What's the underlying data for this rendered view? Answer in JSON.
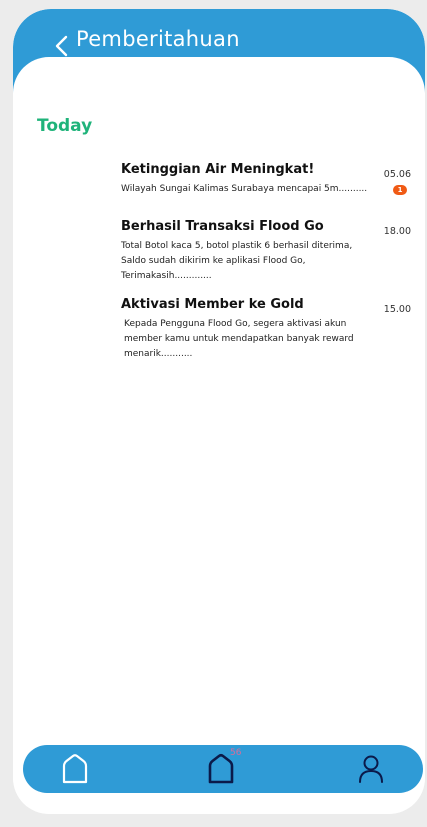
{
  "header": {
    "title": "Pemberitahuan"
  },
  "section": {
    "label": "Today"
  },
  "notifications": [
    {
      "title": "Ketinggian Air Meningkat!",
      "body": "Wilayah Sungai Kalimas Surabaya mencapai 5m..........",
      "time": "05.06",
      "badge": "1"
    },
    {
      "title": "Berhasil Transaksi Flood Go",
      "body": "Total Botol kaca 5, botol plastik 6 berhasil diterima, Saldo sudah dikirim ke aplikasi Flood Go, Terimakasih.............",
      "time": "18.00"
    },
    {
      "title": "Aktivasi Member ke Gold",
      "body": "Kepada Pengguna Flood Go, segera aktivasi akun member kamu untuk mendapatkan banyak reward menarik...........",
      "time": "15.00"
    }
  ],
  "navbar": {
    "notification_count": "56",
    "colors": {
      "bar": "#2f9bd6",
      "active_icon": "#0b1a4a",
      "inactive_icon": "#ffffff"
    }
  }
}
